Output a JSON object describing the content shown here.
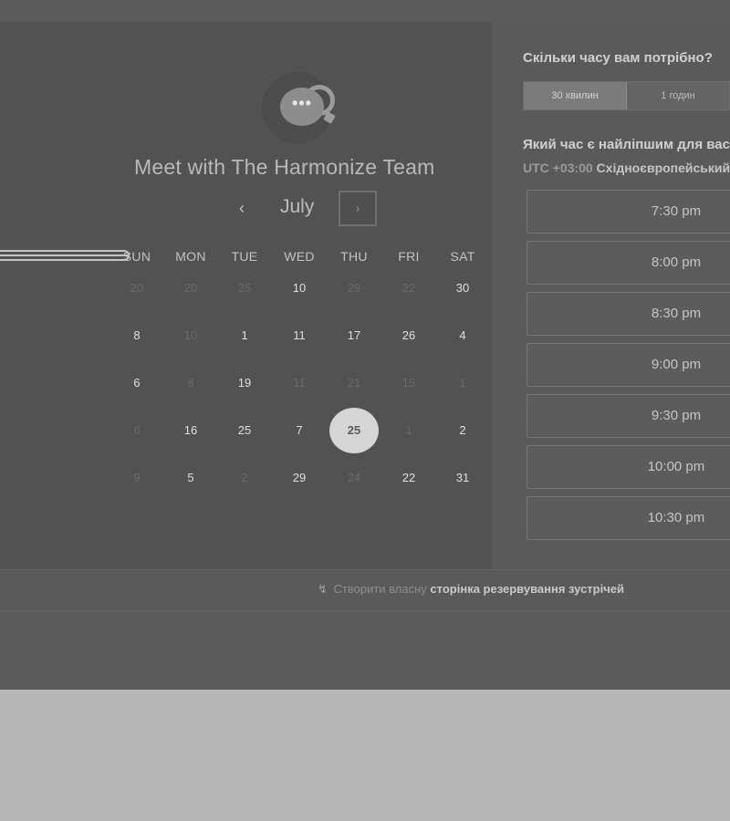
{
  "header": {
    "logo_dots": "•••",
    "title": "Meet with The Harmonize Team"
  },
  "calendar": {
    "month": "July",
    "prev_icon": "‹",
    "next_icon": "›",
    "weekdays": [
      "SUN",
      "MON",
      "TUE",
      "WED",
      "THU",
      "FRI",
      "SAT"
    ],
    "weeks": [
      [
        {
          "d": "20",
          "on": false
        },
        {
          "d": "20",
          "on": false
        },
        {
          "d": "25",
          "on": false
        },
        {
          "d": "10",
          "on": true
        },
        {
          "d": "29",
          "on": false
        },
        {
          "d": "22",
          "on": false
        },
        {
          "d": "30",
          "on": true
        }
      ],
      [
        {
          "d": "8",
          "on": true
        },
        {
          "d": "10",
          "on": false
        },
        {
          "d": "1",
          "on": true
        },
        {
          "d": "11",
          "on": true
        },
        {
          "d": "17",
          "on": true
        },
        {
          "d": "26",
          "on": true
        },
        {
          "d": "4",
          "on": true
        }
      ],
      [
        {
          "d": "6",
          "on": true
        },
        {
          "d": "8",
          "on": false
        },
        {
          "d": "19",
          "on": true
        },
        {
          "d": "11",
          "on": false
        },
        {
          "d": "21",
          "on": false
        },
        {
          "d": "15",
          "on": false
        },
        {
          "d": "1",
          "on": false
        }
      ],
      [
        {
          "d": "6",
          "on": false
        },
        {
          "d": "16",
          "on": true
        },
        {
          "d": "25",
          "on": true
        },
        {
          "d": "7",
          "on": true
        },
        {
          "d": "25",
          "on": true,
          "selected": true
        },
        {
          "d": "1",
          "on": false
        },
        {
          "d": "2",
          "on": true
        }
      ],
      [
        {
          "d": "9",
          "on": false
        },
        {
          "d": "5",
          "on": true
        },
        {
          "d": "2",
          "on": false
        },
        {
          "d": "29",
          "on": true
        },
        {
          "d": "24",
          "on": false
        },
        {
          "d": "22",
          "on": true
        },
        {
          "d": "31",
          "on": true
        }
      ]
    ]
  },
  "scheduler": {
    "duration_question": "Скільки часу вам потрібно?",
    "durations": [
      "30 хвилин",
      "1 годин"
    ],
    "time_question": "Який час є найліпшим для вас?",
    "timezone_offset": "UTC +03:00",
    "timezone_name": "Східноєвропейський час",
    "slots": [
      "7:30 pm",
      "8:00 pm",
      "8:30 pm",
      "9:00 pm",
      "9:30 pm",
      "10:00 pm",
      "10:30 pm"
    ]
  },
  "footer": {
    "icon": "↯",
    "prefix": "Створити власну",
    "link": "сторінка резервування зустрічей"
  }
}
